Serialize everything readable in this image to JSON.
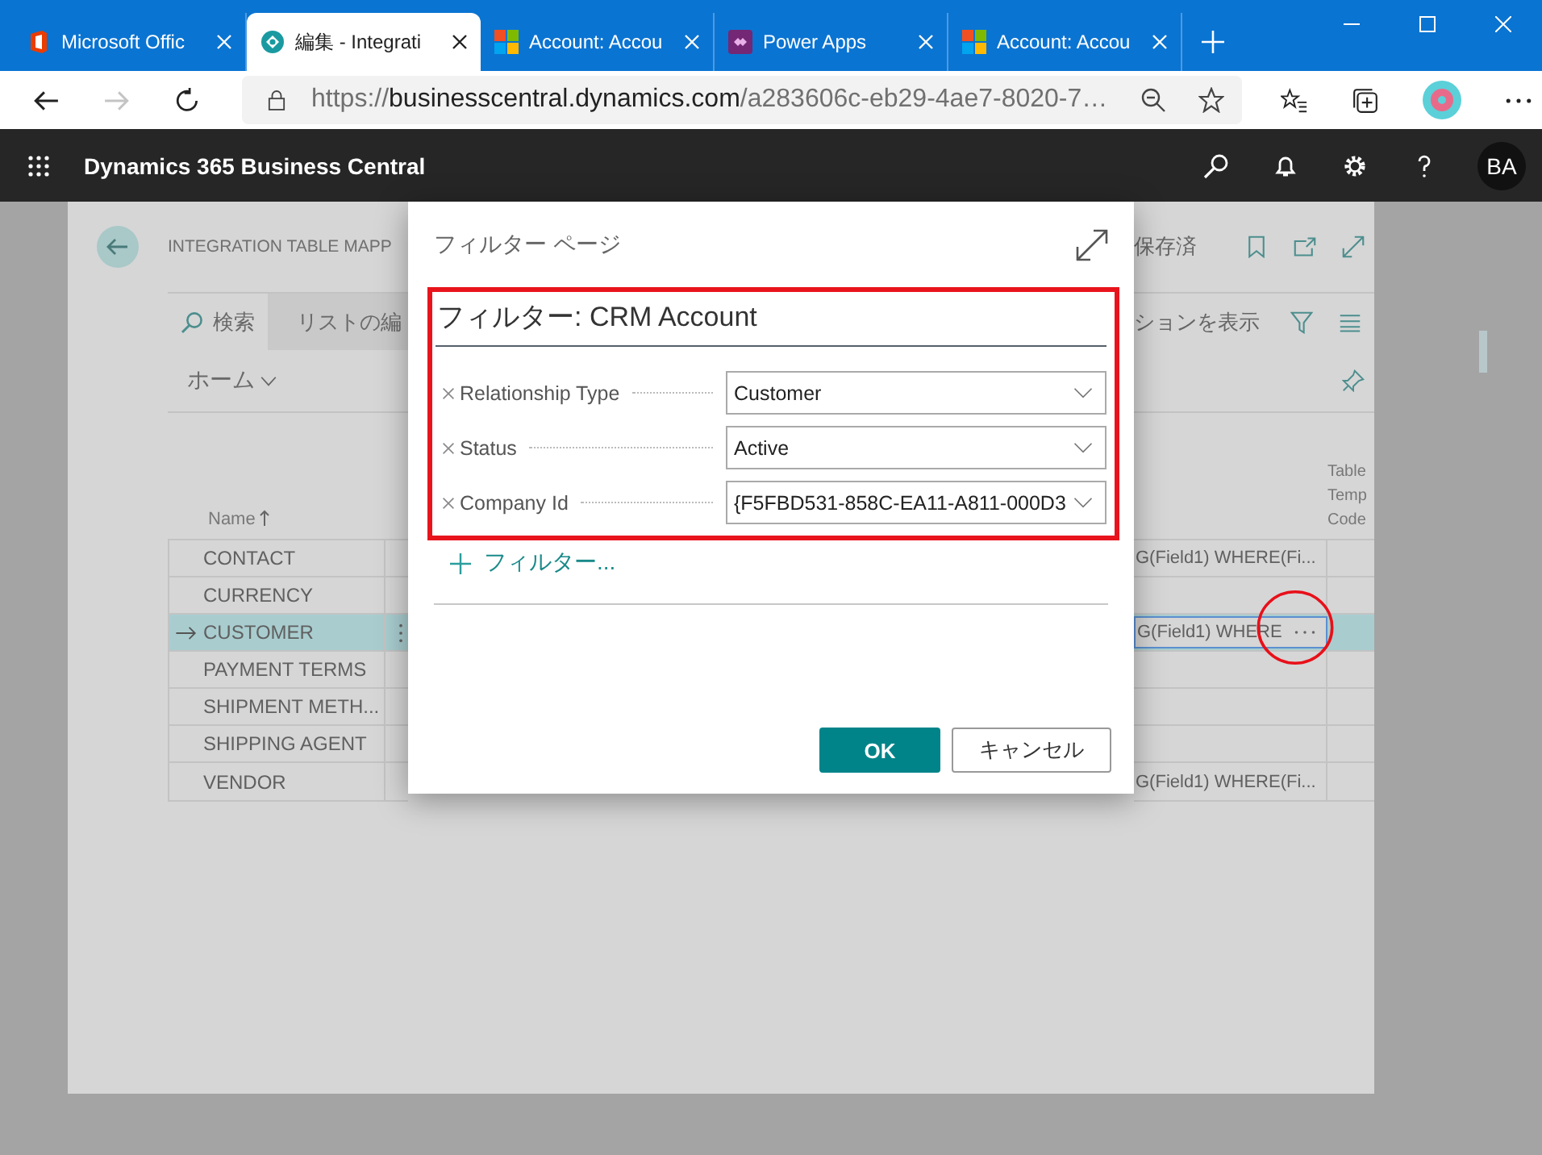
{
  "browser": {
    "tabs": [
      {
        "title": "Microsoft Offic",
        "kind": "office",
        "selected": false
      },
      {
        "title": "編集 - Integrati",
        "kind": "bc",
        "selected": true
      },
      {
        "title": "Account: Accou",
        "kind": "ms",
        "selected": false
      },
      {
        "title": "Power Apps",
        "kind": "powerapps",
        "selected": false
      },
      {
        "title": "Account: Accou",
        "kind": "ms",
        "selected": false
      }
    ],
    "forward_enabled": false,
    "url": {
      "scheme": "https://",
      "host": "businesscentral.dynamics.com",
      "path": "/a283606c-eb29-4ae7-8020-7…"
    }
  },
  "app_bar": {
    "title": "Dynamics 365 Business Central",
    "avatar": "BA"
  },
  "page": {
    "title": "INTEGRATION TABLE MAPP",
    "status": "保存済",
    "actions": [
      {
        "label": "検索",
        "kind": "search"
      },
      {
        "label": "リストの編",
        "kind": "edit-list"
      }
    ],
    "show_options": "ションを表示",
    "menu": "ホーム",
    "table": {
      "name_column": "Name",
      "column_3": "Table Temp Code",
      "rows": [
        {
          "name": "CONTACT",
          "selected": false,
          "column_2": "G(Field1) WHERE(Fi..."
        },
        {
          "name": "CURRENCY",
          "selected": false
        },
        {
          "name": "CUSTOMER",
          "selected": true,
          "column_2": "G(Field1) WHERE"
        },
        {
          "name": "PAYMENT TERMS",
          "selected": false
        },
        {
          "name": "SHIPMENT METH...",
          "selected": false
        },
        {
          "name": "SHIPPING AGENT",
          "selected": false
        },
        {
          "name": "VENDOR",
          "selected": false,
          "column_2": "G(Field1) WHERE(Fi..."
        }
      ]
    }
  },
  "dialog": {
    "title": "フィルター ページ",
    "heading": "フィルター: CRM Account",
    "filters": [
      {
        "label": "Relationship Type",
        "value": "Customer"
      },
      {
        "label": "Status",
        "value": "Active"
      },
      {
        "label": "Company Id",
        "value": "{F5FBD531-858C-EA11-A811-000D3"
      }
    ],
    "add_filter": "フィルター...",
    "buttons": [
      {
        "label": "OK",
        "kind": "primary"
      },
      {
        "label": "キャンセル",
        "kind": "secondary"
      }
    ]
  }
}
